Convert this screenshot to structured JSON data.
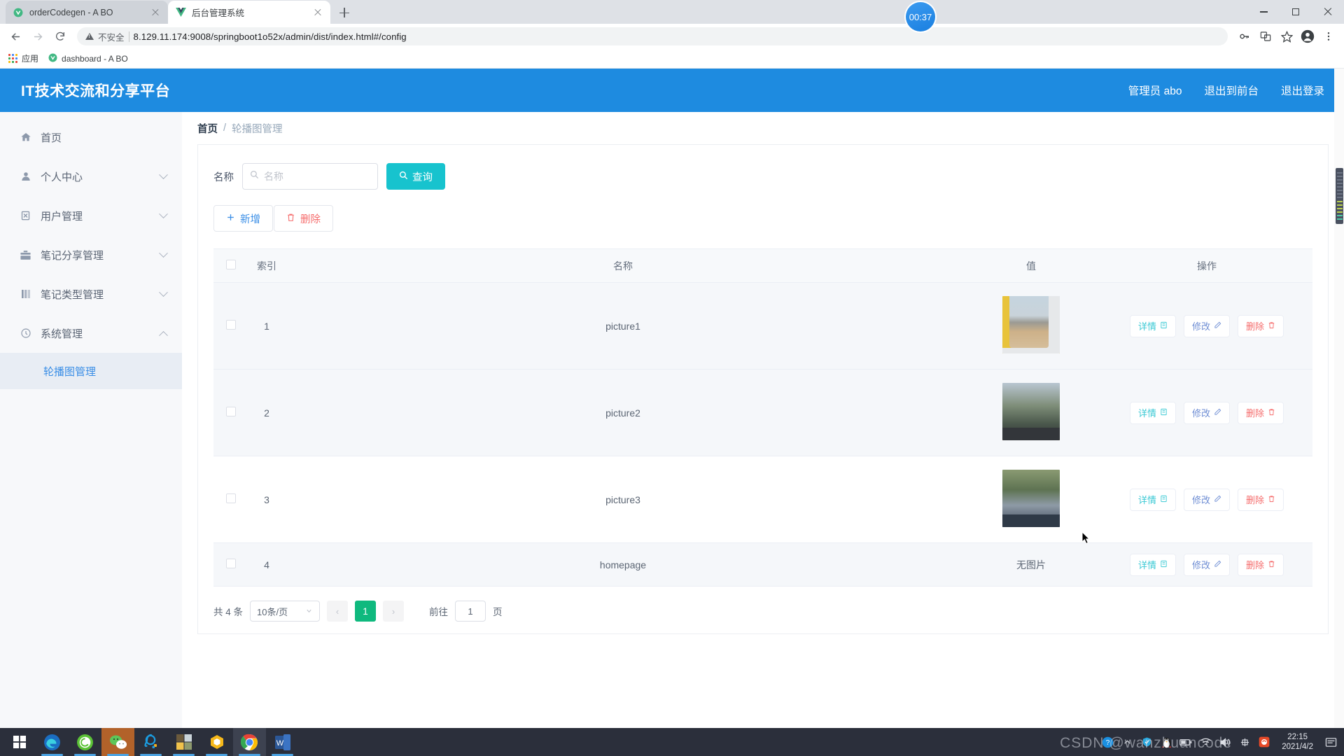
{
  "browser": {
    "tabs": [
      {
        "title": "orderCodegen - A BO",
        "favicon": "vue-icon",
        "active": false
      },
      {
        "title": "后台管理系统",
        "favicon": "vue-icon",
        "active": true
      }
    ],
    "new_tab_label": "+",
    "window_controls": {
      "minimize": "minimize",
      "maximize": "maximize",
      "close": "close"
    },
    "nav": {
      "back": "←",
      "forward": "→",
      "reload": "⟳"
    },
    "omnibox": {
      "security_label": "不安全",
      "url": "8.129.11.174:9008/springboot1o52x/admin/dist/index.html#/config"
    },
    "timer_badge": "00:37",
    "toolbar_icons": [
      "key-icon",
      "translate-icon",
      "bookmark-star-icon",
      "profile-avatar-icon",
      "chrome-menu-icon"
    ],
    "bookmarks": [
      {
        "label": "应用",
        "icon": "apps-grid-icon"
      },
      {
        "label": "dashboard - A BO",
        "icon": "vue-icon"
      }
    ]
  },
  "app": {
    "title": "IT技术交流和分享平台",
    "header_links": [
      "管理员 abo",
      "退出到前台",
      "退出登录"
    ],
    "accent": "#1e8be0",
    "sidebar": {
      "items": [
        {
          "label": "首页",
          "icon": "home-icon",
          "expandable": false
        },
        {
          "label": "个人中心",
          "icon": "user-icon",
          "expandable": true,
          "expanded": false
        },
        {
          "label": "用户管理",
          "icon": "clipboard-icon",
          "expandable": true,
          "expanded": false
        },
        {
          "label": "笔记分享管理",
          "icon": "briefcase-icon",
          "expandable": true,
          "expanded": false
        },
        {
          "label": "笔记类型管理",
          "icon": "book-icon",
          "expandable": true,
          "expanded": false
        },
        {
          "label": "系统管理",
          "icon": "clock-icon",
          "expandable": true,
          "expanded": true
        }
      ],
      "active_sub_item": "轮播图管理"
    },
    "breadcrumb": {
      "home": "首页",
      "separator": "/",
      "current": "轮播图管理"
    },
    "search": {
      "label": "名称",
      "placeholder": "名称",
      "value": "",
      "button_label": "查询",
      "button_color": "#17c3ce"
    },
    "actions": [
      {
        "label": "新增",
        "icon": "plus-icon",
        "color": "#3a8ee6"
      },
      {
        "label": "删除",
        "icon": "trash-icon",
        "color": "#f56c6c"
      }
    ],
    "table": {
      "columns": [
        "",
        "索引",
        "名称",
        "值",
        "操作"
      ],
      "rows": [
        {
          "index": "1",
          "name": "picture1",
          "value_type": "image",
          "value_text": "",
          "highlight": true
        },
        {
          "index": "2",
          "name": "picture2",
          "value_type": "image",
          "value_text": "",
          "highlight": true
        },
        {
          "index": "3",
          "name": "picture3",
          "value_type": "image",
          "value_text": "",
          "highlight": false
        },
        {
          "index": "4",
          "name": "homepage",
          "value_type": "text",
          "value_text": "无图片",
          "highlight": true
        }
      ],
      "row_actions": [
        {
          "label": "详情",
          "icon": "document-icon",
          "color": "#3bc9d4"
        },
        {
          "label": "修改",
          "icon": "pencil-icon",
          "color": "#6f8ed4"
        },
        {
          "label": "删除",
          "icon": "trash-icon",
          "color": "#f56c6c"
        }
      ]
    },
    "pagination": {
      "total_label": "共 4 条",
      "page_size": "10条/页",
      "prev": "‹",
      "current_page": "1",
      "next": "›",
      "goto_label": "前往",
      "goto_value": "1",
      "page_unit": "页",
      "active_color": "#0fb97e"
    }
  },
  "taskbar": {
    "start": "windows-logo-icon",
    "apps": [
      {
        "name": "edge-icon",
        "running": true
      },
      {
        "name": "360-browser-icon",
        "running": true
      },
      {
        "name": "wechat-icon",
        "running": true,
        "focused": true
      },
      {
        "name": "qq-icon",
        "running": true
      },
      {
        "name": "photos-icon",
        "running": true
      },
      {
        "name": "hexagon-app-icon",
        "running": true
      },
      {
        "name": "chrome-icon",
        "running": true,
        "active": true
      },
      {
        "name": "word-icon",
        "running": true
      }
    ],
    "tray": [
      "help-icon",
      "chevron-up-icon",
      "shield-icon",
      "qq-penguin-icon",
      "battery-icon",
      "wifi-icon",
      "volume-icon",
      "ime-icon",
      "app-tray-icon"
    ],
    "clock": {
      "time": "22:15",
      "date": "2021/4/2"
    },
    "notification": "notification-icon"
  },
  "watermark": "CSDN @wanzhuancode"
}
